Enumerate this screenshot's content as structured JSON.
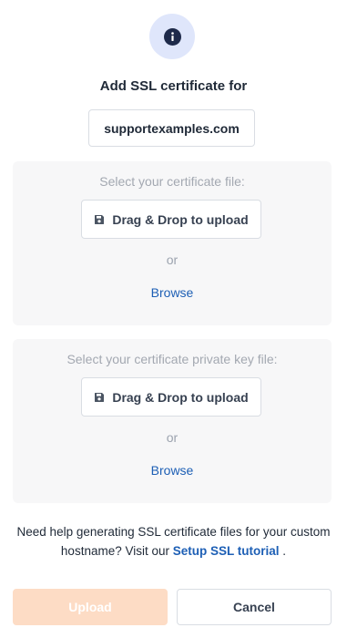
{
  "header": {
    "icon": "info-icon",
    "title": "Add SSL certificate for",
    "hostname": "supportexamples.com"
  },
  "certificate_panel": {
    "label": "Select your certificate file:",
    "dnd_label": "Drag & Drop to upload",
    "dnd_icon": "save-icon",
    "or_text": "or",
    "browse_label": "Browse"
  },
  "private_key_panel": {
    "label": "Select your certificate private key file:",
    "dnd_label": "Drag & Drop to upload",
    "dnd_icon": "save-icon",
    "or_text": "or",
    "browse_label": "Browse"
  },
  "help": {
    "text_before": "Need help generating SSL certificate files for your custom hostname? Visit our",
    "link_label": "Setup SSL tutorial",
    "text_after": "."
  },
  "footer": {
    "upload_label": "Upload",
    "cancel_label": "Cancel"
  },
  "colors": {
    "accent_link": "#1d5fb5",
    "upload_disabled": "#fddcc5",
    "info_circle": "#dfe6fb"
  }
}
